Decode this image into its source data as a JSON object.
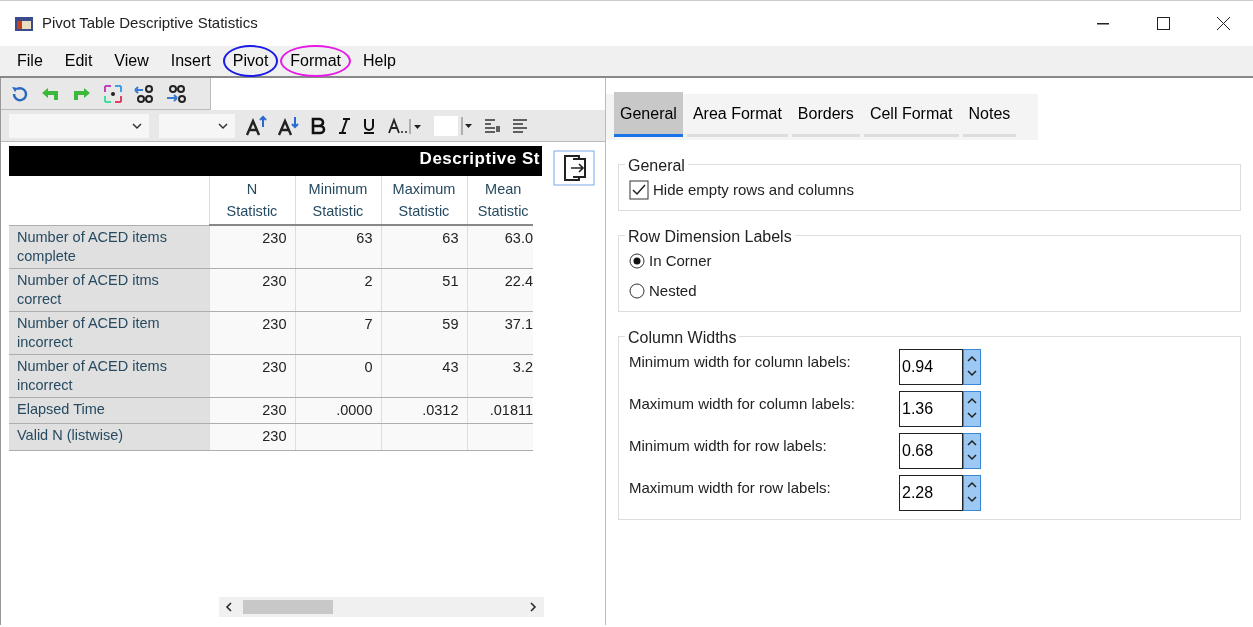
{
  "window": {
    "title": "Pivot Table Descriptive Statistics"
  },
  "menu": [
    {
      "label": "File"
    },
    {
      "label": "Edit"
    },
    {
      "label": "View"
    },
    {
      "label": "Insert"
    },
    {
      "label": "Pivot",
      "color": "#1a1ae6"
    },
    {
      "label": "Format",
      "color": "#e61ae6"
    },
    {
      "label": "Help"
    }
  ],
  "table": {
    "title": "Descriptive St",
    "columns": [
      {
        "top": "N",
        "bottom": "Statistic"
      },
      {
        "top": "Minimum",
        "bottom": "Statistic"
      },
      {
        "top": "Maximum",
        "bottom": "Statistic"
      },
      {
        "top": "Mean",
        "bottom": "Statistic"
      }
    ],
    "rows": [
      {
        "label": "Number of ACED items complete",
        "cells": [
          "230",
          "63",
          "63",
          "63.0"
        ]
      },
      {
        "label": "Number of ACED itms correct",
        "cells": [
          "230",
          "2",
          "51",
          "22.4"
        ]
      },
      {
        "label": "Number of ACED item incorrect",
        "cells": [
          "230",
          "7",
          "59",
          "37.1"
        ]
      },
      {
        "label": "Number of ACED items incorrect",
        "cells": [
          "230",
          "0",
          "43",
          "3.2"
        ]
      },
      {
        "label": "Elapsed Time",
        "cells": [
          "230",
          ".0000",
          ".0312",
          ".01811"
        ]
      },
      {
        "label": "Valid N (listwise)",
        "cells": [
          "230"
        ]
      }
    ]
  },
  "tabs": [
    {
      "label": "General",
      "selected": true
    },
    {
      "label": "Area Format",
      "selected": false
    },
    {
      "label": "Borders",
      "selected": false
    },
    {
      "label": "Cell Format",
      "selected": false
    },
    {
      "label": "Notes",
      "selected": false
    }
  ],
  "general": {
    "title": "General",
    "checkbox": {
      "label": "Hide empty rows and columns",
      "checked": true
    }
  },
  "row_dimension": {
    "title": "Row Dimension Labels",
    "options": [
      {
        "label": "In Corner",
        "selected": true
      },
      {
        "label": "Nested",
        "selected": false
      }
    ]
  },
  "column_widths": {
    "title": "Column Widths",
    "fields": [
      {
        "label": "Minimum width for column labels:",
        "value": "0.94"
      },
      {
        "label": "Maximum width for column labels:",
        "value": "1.36"
      },
      {
        "label": "Minimum width for row labels:",
        "value": "0.68"
      },
      {
        "label": "Maximum width for row labels:",
        "value": "2.28"
      }
    ]
  }
}
